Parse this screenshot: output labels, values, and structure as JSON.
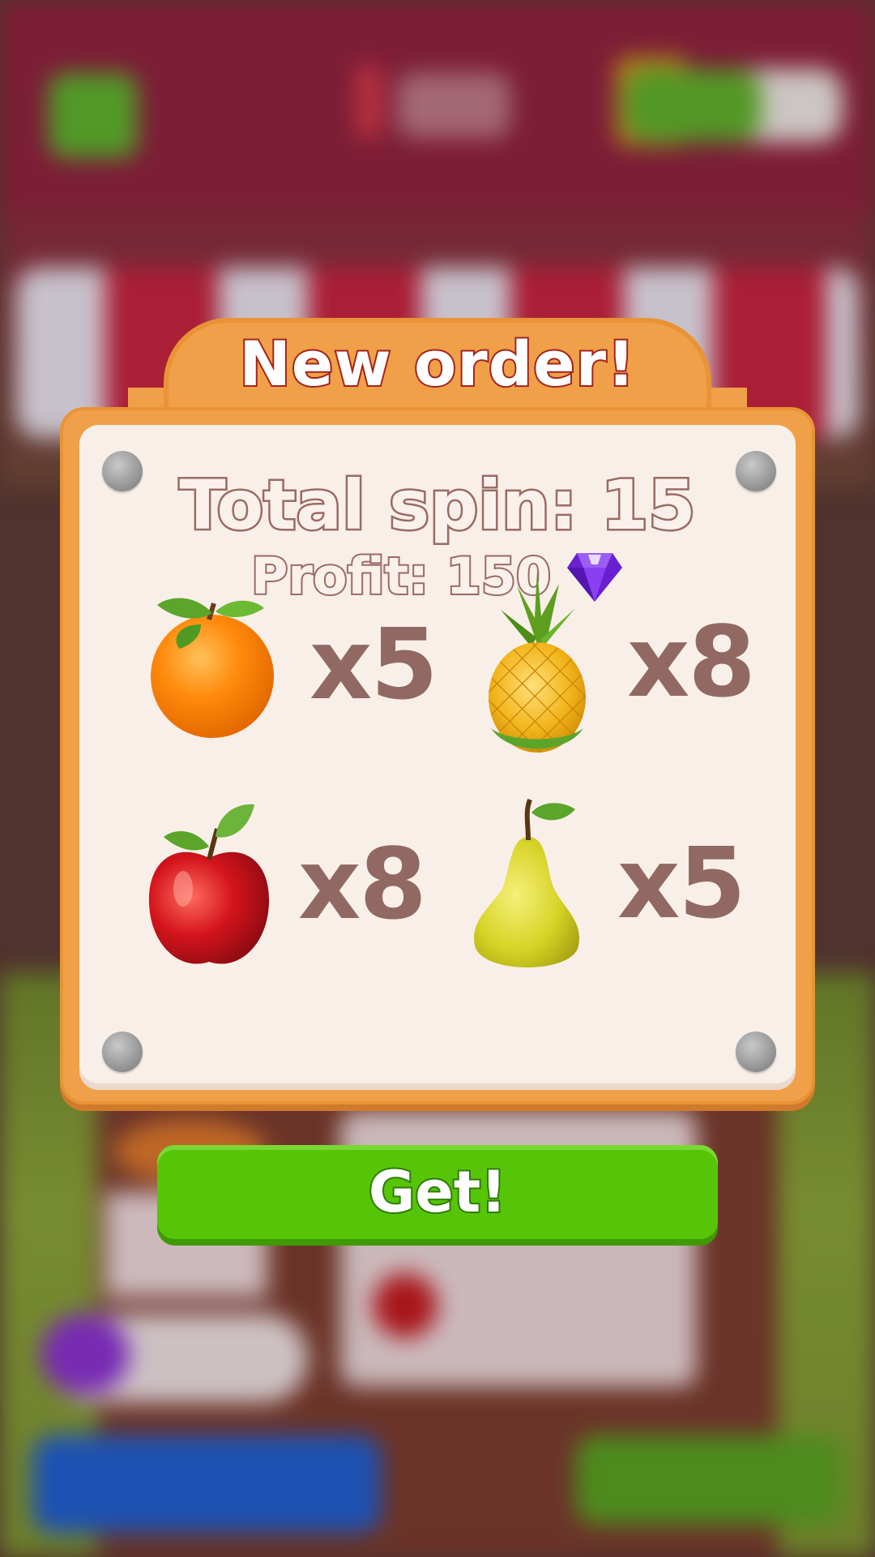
{
  "dialog": {
    "title": "New order!",
    "total_spin": "Total spin: 15",
    "profit": "Profit: 150",
    "profit_currency_icon": "purple-gem-icon",
    "items": [
      {
        "fruit": "orange",
        "icon": "orange-icon",
        "quantity": "x5"
      },
      {
        "fruit": "pineapple",
        "icon": "pineapple-icon",
        "quantity": "x8"
      },
      {
        "fruit": "apple",
        "icon": "apple-icon",
        "quantity": "x8"
      },
      {
        "fruit": "pear",
        "icon": "pear-icon",
        "quantity": "x5"
      }
    ]
  },
  "get_button": {
    "label": "Get!"
  },
  "colors": {
    "frame": "#f0a048",
    "panel": "#f9efe9",
    "title_outline": "#a3231c",
    "quantity_text": "#916962",
    "button_green": "#56c508"
  }
}
